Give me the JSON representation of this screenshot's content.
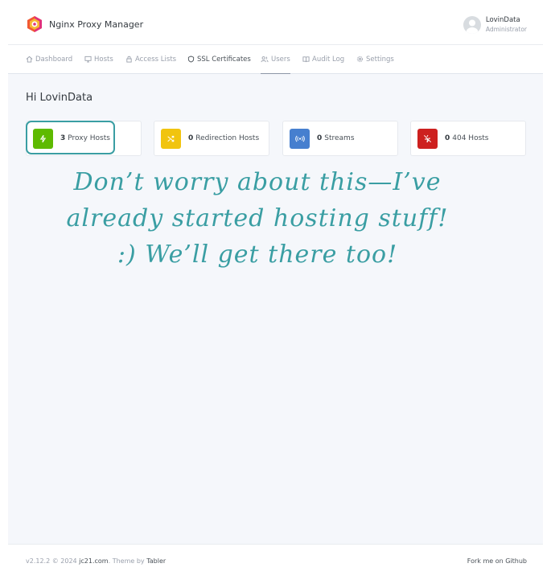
{
  "header": {
    "app_name": "Nginx Proxy Manager",
    "user_name": "LovinData",
    "user_role": "Administrator"
  },
  "nav": [
    {
      "label": "Dashboard",
      "icon": "home-icon"
    },
    {
      "label": "Hosts",
      "icon": "monitor-icon"
    },
    {
      "label": "Access Lists",
      "icon": "lock-icon"
    },
    {
      "label": "SSL Certificates",
      "icon": "shield-icon"
    },
    {
      "label": "Users",
      "icon": "users-icon"
    },
    {
      "label": "Audit Log",
      "icon": "book-icon"
    },
    {
      "label": "Settings",
      "icon": "gear-icon"
    }
  ],
  "main": {
    "greeting": "Hi LovinData",
    "cards": [
      {
        "count": "3",
        "label": "Proxy Hosts",
        "color": "#5eba00",
        "icon": "zap-icon"
      },
      {
        "count": "0",
        "label": "Redirection Hosts",
        "color": "#f1c40f",
        "icon": "shuffle-icon"
      },
      {
        "count": "0",
        "label": "Streams",
        "color": "#467fcf",
        "icon": "radio-icon"
      },
      {
        "count": "0",
        "label": "404 Hosts",
        "color": "#cd201f",
        "icon": "zap-off-icon"
      }
    ],
    "note_lines": [
      "Don’t worry about this—I’ve",
      "already started hosting stuff!",
      ":) We’ll get there too!"
    ],
    "note_color": "#3a9ea3"
  },
  "footer": {
    "version": "v2.12.2 © 2024",
    "link_site": "jc21.com",
    "theme_text": ". Theme by",
    "link_theme": "Tabler",
    "fork": "Fork me on Github"
  }
}
